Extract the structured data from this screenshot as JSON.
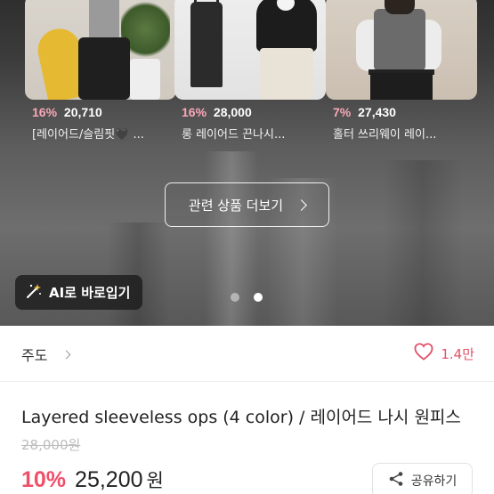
{
  "related_products": [
    {
      "discount": "16%",
      "price": "20,710",
      "name": "[레이어드/슬림핏🖤 ..."
    },
    {
      "discount": "16%",
      "price": "28,000",
      "name": "롱 레이어드 끈나시..."
    },
    {
      "discount": "7%",
      "price": "27,430",
      "name": "홀터 쓰리웨이 레이..."
    }
  ],
  "related_button_label": "관련 상품 더보기",
  "ai_button_label": "AI로 바로입기",
  "pagination": {
    "total": 2,
    "active_index": 1
  },
  "seller": {
    "name": "주도"
  },
  "likes": {
    "count": "1.4만"
  },
  "product": {
    "title": "Layered sleeveless ops (4 color) / 레이어드 나시 원피스",
    "original_price": "28,000원",
    "discount": "10%",
    "price": "25,200",
    "currency": "원"
  },
  "share_button_label": "공유하기",
  "colors": {
    "discount_pink": "#f04f6a",
    "card_discount_pink": "#f9a8b8",
    "heart_red": "#e2526b"
  },
  "icons": {
    "wand": "magic-wand-icon",
    "heart": "heart-outline-icon",
    "share": "share-icon",
    "chevron": "chevron-right-icon"
  }
}
